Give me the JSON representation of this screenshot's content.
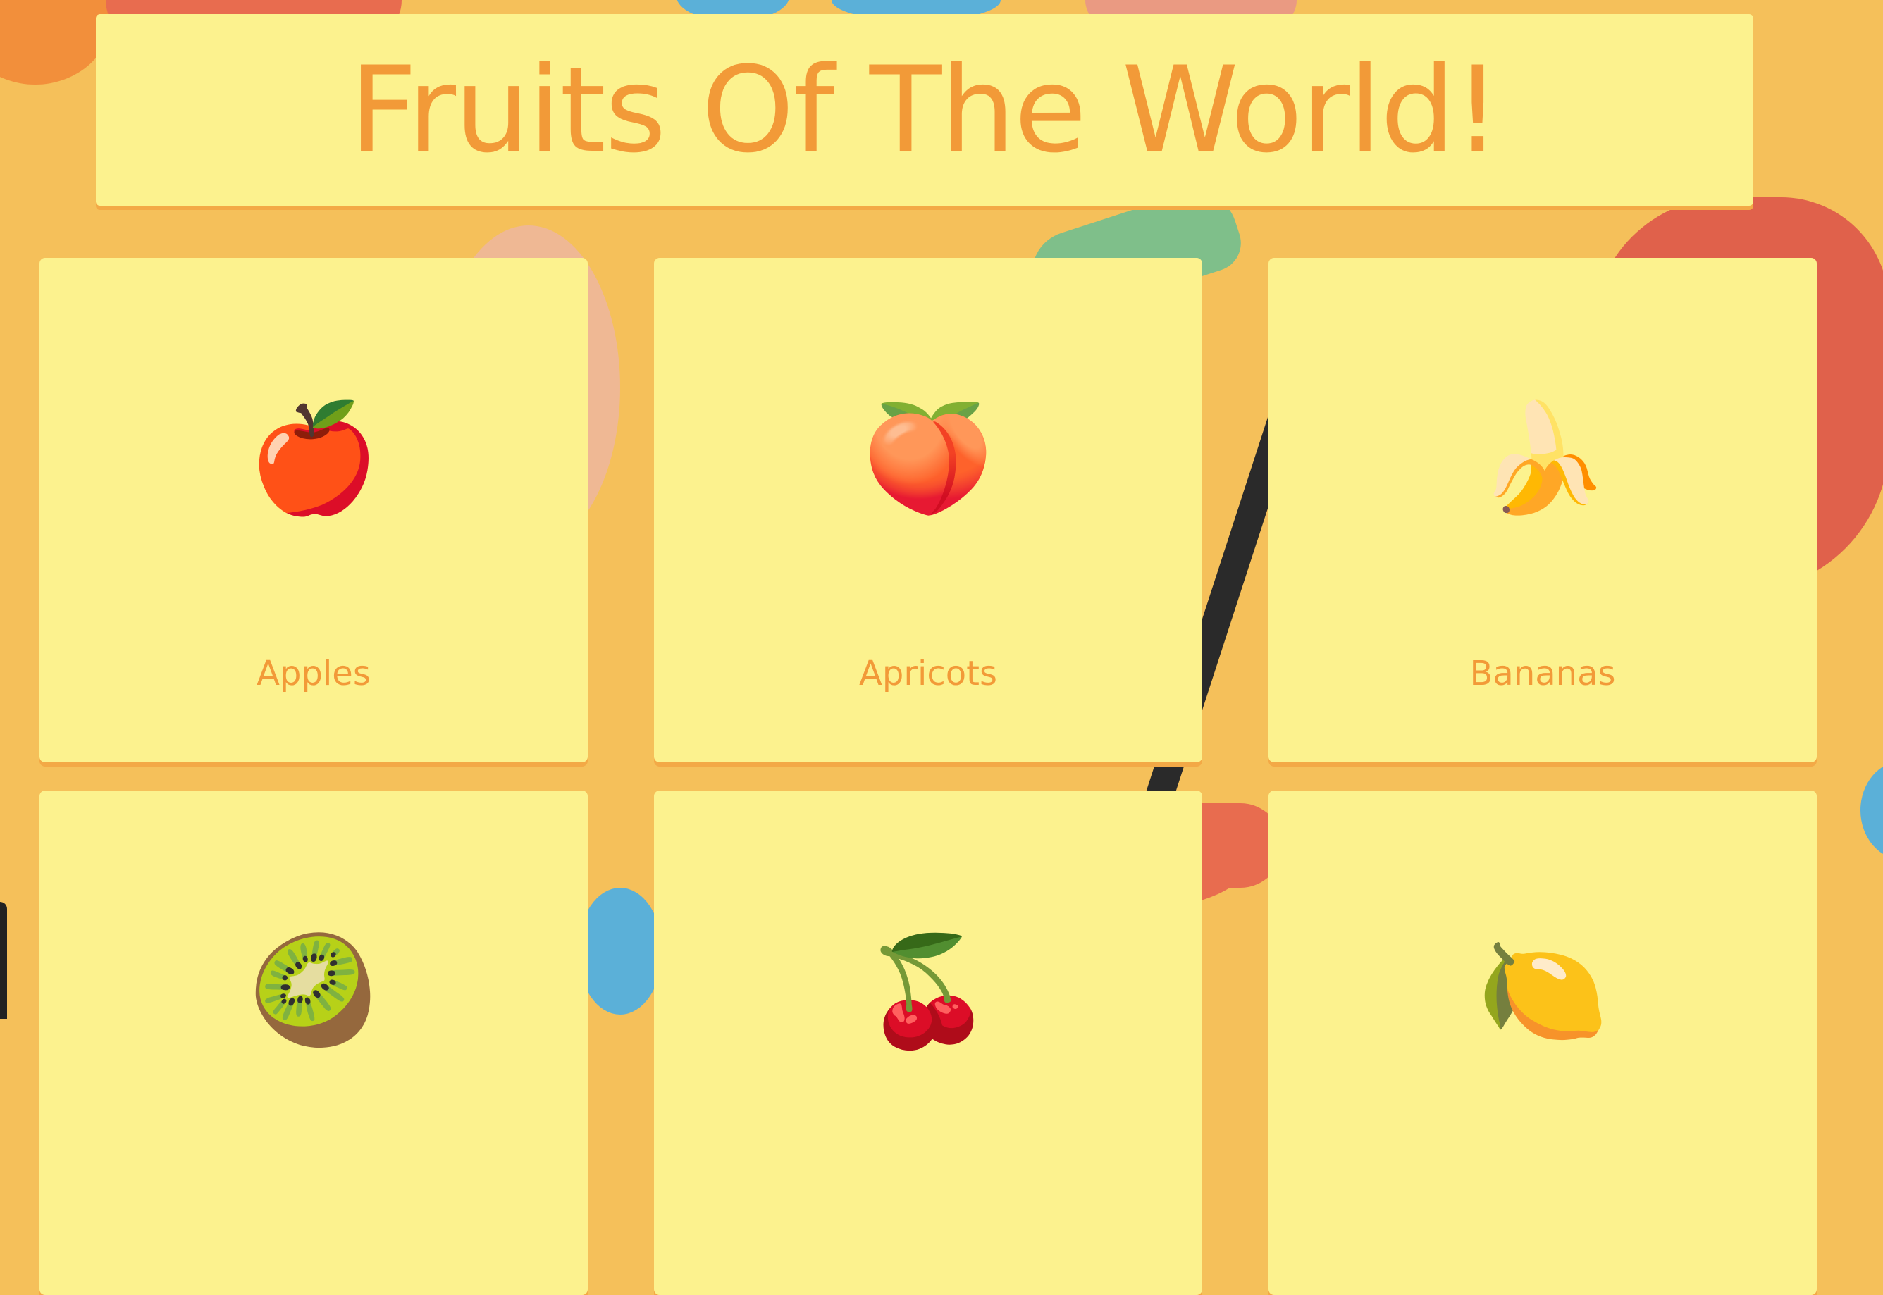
{
  "header": {
    "title": "Fruits Of The World!"
  },
  "cards": [
    {
      "emoji": "🍎",
      "icon": "apple-icon",
      "label": "Apples"
    },
    {
      "emoji": "🍑",
      "icon": "peach-icon",
      "label": "Apricots"
    },
    {
      "emoji": "🍌",
      "icon": "banana-icon",
      "label": "Bananas"
    },
    {
      "emoji": "🥝",
      "icon": "kiwi-icon",
      "label": ""
    },
    {
      "emoji": "🍒",
      "icon": "cherries-icon",
      "label": ""
    },
    {
      "emoji": "🍋",
      "icon": "lemon-icon",
      "label": ""
    }
  ],
  "colors": {
    "card_background": "#fcf28e",
    "text_orange": "#f29a38",
    "page_background": "#f5c05a"
  }
}
